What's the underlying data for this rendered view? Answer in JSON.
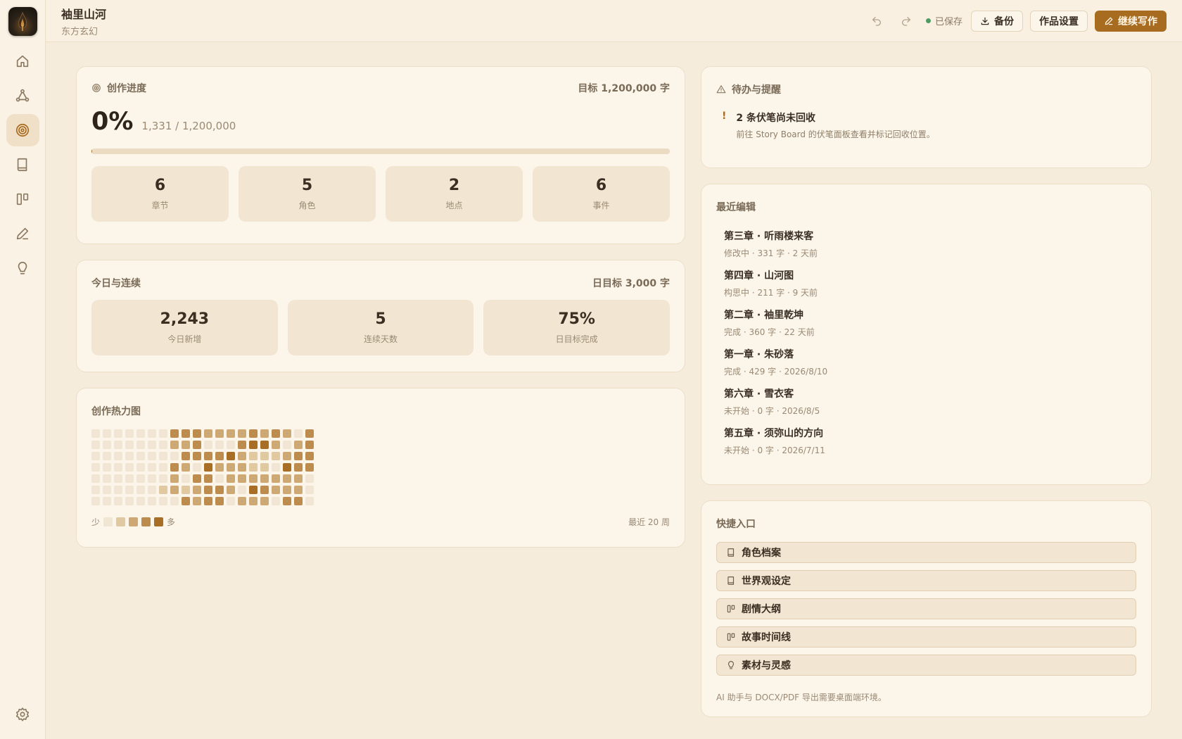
{
  "header": {
    "title": "袖里山河",
    "genre": "东方玄幻",
    "saved_label": "已保存",
    "backup_label": "备份",
    "settings_label": "作品设置",
    "continue_label": "继续写作"
  },
  "progress": {
    "title": "创作进度",
    "target_label": "目标 1,200,000 字",
    "percent_label": "0%",
    "percent_value": 0.0011,
    "count_label": "1,331 / 1,200,000",
    "stats": [
      {
        "value": "6",
        "label": "章节"
      },
      {
        "value": "5",
        "label": "角色"
      },
      {
        "value": "2",
        "label": "地点"
      },
      {
        "value": "6",
        "label": "事件"
      }
    ]
  },
  "today": {
    "title": "今日与连续",
    "target_label": "日目标 3,000 字",
    "stats": [
      {
        "value": "2,243",
        "label": "今日新增"
      },
      {
        "value": "5",
        "label": "连续天数"
      },
      {
        "value": "75%",
        "label": "日目标完成"
      }
    ]
  },
  "heatmap": {
    "title": "创作热力图",
    "legend_less": "少",
    "legend_more": "多",
    "range_label": "最近 20 周",
    "colors": [
      "#f1e6d3",
      "#e0c8a1",
      "#cda874",
      "#bb8c4d",
      "#a96e26"
    ],
    "levels": [
      [
        0,
        0,
        0,
        0,
        0,
        0,
        0
      ],
      [
        0,
        0,
        0,
        0,
        0,
        0,
        0
      ],
      [
        0,
        0,
        0,
        0,
        0,
        0,
        0
      ],
      [
        0,
        0,
        0,
        0,
        0,
        0,
        0
      ],
      [
        0,
        0,
        0,
        0,
        0,
        0,
        0
      ],
      [
        0,
        0,
        0,
        0,
        0,
        0,
        0
      ],
      [
        0,
        0,
        0,
        0,
        0,
        1,
        0
      ],
      [
        3,
        2,
        0,
        3,
        2,
        2,
        0
      ],
      [
        3,
        2,
        3,
        2,
        0,
        1,
        3
      ],
      [
        3,
        3,
        3,
        0,
        3,
        2,
        2
      ],
      [
        2,
        0,
        3,
        4,
        3,
        3,
        3
      ],
      [
        2,
        0,
        3,
        2,
        0,
        3,
        3
      ],
      [
        2,
        0,
        4,
        2,
        2,
        2,
        0
      ],
      [
        2,
        3,
        2,
        2,
        2,
        0,
        2
      ],
      [
        3,
        4,
        1,
        1,
        2,
        4,
        2
      ],
      [
        2,
        4,
        1,
        1,
        2,
        3,
        2
      ],
      [
        3,
        2,
        1,
        0,
        2,
        2,
        0
      ],
      [
        2,
        0,
        2,
        4,
        2,
        2,
        3
      ],
      [
        0,
        2,
        3,
        3,
        2,
        2,
        3
      ],
      [
        3,
        3,
        3,
        3,
        0,
        0,
        0
      ]
    ]
  },
  "todo": {
    "title": "待办与提醒",
    "items": [
      {
        "mark": "!",
        "title": "2 条伏笔尚未回收",
        "desc": "前往 Story Board 的伏笔面板查看并标记回收位置。"
      }
    ]
  },
  "recent": {
    "title": "最近编辑",
    "items": [
      {
        "title": "第三章 · 听雨楼来客",
        "meta": "修改中 · 331 字 · 2 天前"
      },
      {
        "title": "第四章 · 山河图",
        "meta": "构思中 · 211 字 · 9 天前"
      },
      {
        "title": "第二章 · 袖里乾坤",
        "meta": "完成 · 360 字 · 22 天前"
      },
      {
        "title": "第一章 · 朱砂落",
        "meta": "完成 · 429 字 · 2026/8/10"
      },
      {
        "title": "第六章 · 雪衣客",
        "meta": "未开始 · 0 字 · 2026/8/5"
      },
      {
        "title": "第五章 · 须弥山的方向",
        "meta": "未开始 · 0 字 · 2026/7/11"
      }
    ]
  },
  "quick": {
    "title": "快捷入口",
    "items": [
      {
        "label": "角色档案",
        "icon": "book-icon"
      },
      {
        "label": "世界观设定",
        "icon": "book-icon"
      },
      {
        "label": "剧情大纲",
        "icon": "board-icon"
      },
      {
        "label": "故事时间线",
        "icon": "board-icon"
      },
      {
        "label": "素材与灵感",
        "icon": "bulb-icon"
      }
    ],
    "note": "AI 助手与 DOCX/PDF 导出需要桌面端环境。"
  },
  "colors": {
    "accent": "#a76c20",
    "saved_dot": "#4f9a63",
    "background": "#f6ecdb",
    "card": "#fcf5ea"
  }
}
